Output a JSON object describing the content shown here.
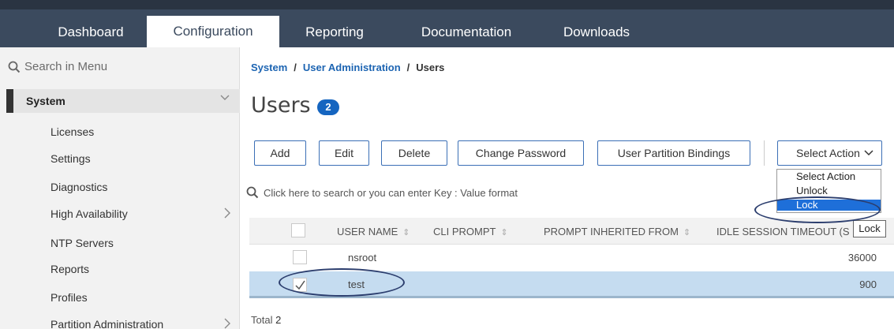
{
  "nav": {
    "tabs": [
      "Dashboard",
      "Configuration",
      "Reporting",
      "Documentation",
      "Downloads"
    ],
    "active": "Configuration"
  },
  "sidebar": {
    "search_placeholder": "Search in Menu",
    "section": "System",
    "items": [
      "Licenses",
      "Settings",
      "Diagnostics",
      "High Availability",
      "NTP Servers",
      "Reports",
      "Profiles",
      "Partition Administration"
    ]
  },
  "breadcrumb": [
    "System",
    "User Administration",
    "Users"
  ],
  "page": {
    "title": "Users",
    "count": "2"
  },
  "toolbar": {
    "add": "Add",
    "edit": "Edit",
    "delete": "Delete",
    "change_password": "Change Password",
    "partition_bindings": "User Partition Bindings",
    "select_action": "Select Action"
  },
  "dropdown": {
    "options": [
      "Select Action",
      "Unlock",
      "Lock"
    ],
    "selected": "Lock"
  },
  "tooltip": "Lock",
  "table": {
    "search_placeholder": "Click here to search or you can enter Key : Value format",
    "columns": [
      "USER NAME",
      "CLI PROMPT",
      "PROMPT INHERITED FROM",
      "IDLE SESSION TIMEOUT (S"
    ],
    "rows": [
      {
        "user": "nsroot",
        "timeout": "36000",
        "checked": false
      },
      {
        "user": "test",
        "timeout": "900",
        "checked": true
      }
    ]
  },
  "footer": {
    "total_label": "Total",
    "total_value": "2"
  },
  "colors": {
    "nav_bg": "#3b4a5e",
    "accent": "#1565c0",
    "selected_row": "#c5dcf0",
    "dropdown_highlight": "#1e6fd9"
  }
}
